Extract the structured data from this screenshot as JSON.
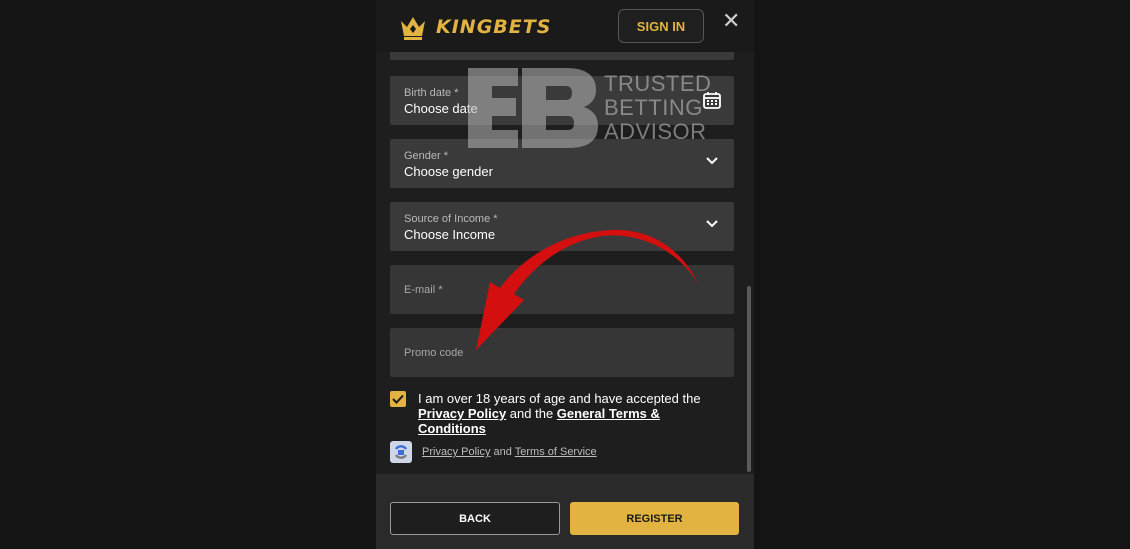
{
  "header": {
    "brand_name": "KINGBETS",
    "signin_label": "SIGN IN",
    "close_symbol": "✕"
  },
  "form": {
    "birth_date": {
      "label": "Birth date *",
      "value": "Choose date",
      "icon": "calendar-icon"
    },
    "gender": {
      "label": "Gender *",
      "value": "Choose gender",
      "icon": "chevron-down-icon"
    },
    "income": {
      "label": "Source of Income *",
      "value": "Choose Income",
      "icon": "chevron-down-icon"
    },
    "email": {
      "label": "E-mail *"
    },
    "promo": {
      "label": "Promo code"
    }
  },
  "consent": {
    "checked": true,
    "text_1": "I am over 18 years of age and have accepted the",
    "privacy_link": "Privacy Policy",
    "and_the": "and the",
    "terms_link": "General Terms & Conditions"
  },
  "captcha": {
    "privacy": "Privacy Policy",
    "and": "and",
    "terms": "Terms of Service"
  },
  "footer": {
    "back_label": "BACK",
    "register_label": "REGISTER"
  },
  "watermark": {
    "line1": "TRUSTED",
    "line2": "BETTING",
    "line3": "ADVISOR"
  },
  "colors": {
    "accent": "#e3b341",
    "background": "#141414",
    "panel": "#1e1e1e",
    "field": "#3a3a3a",
    "arrow": "#d40f0f"
  }
}
